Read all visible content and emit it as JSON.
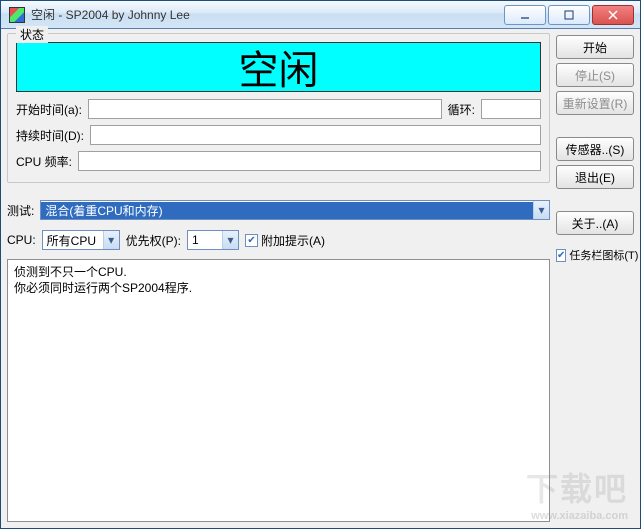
{
  "titlebar": {
    "title": "空闲 - SP2004 by Johnny Lee"
  },
  "status_group": {
    "label": "状态",
    "banner_text": "空闲",
    "start_time_label": "开始时间(a):",
    "loop_label": "循环:",
    "duration_label": "持续时间(D):",
    "cpu_freq_label": "CPU 频率:"
  },
  "test_row": {
    "label": "测试:",
    "selected": "混合(着重CPU和内存)"
  },
  "cpu_row": {
    "cpu_label": "CPU:",
    "cpu_selected": "所有CPU",
    "priority_label": "优先权(P):",
    "priority_value": "1",
    "extra_hint_label": "附加提示(A)"
  },
  "log_text": "侦测到不只一个CPU.\n你必须同时运行两个SP2004程序.",
  "buttons": {
    "start": "开始",
    "stop": "停止(S)",
    "reset": "重新设置(R)",
    "sensor": "传感器..(S)",
    "exit": "退出(E)",
    "about": "关于..(A)",
    "tray_label": "任务栏图标(T)"
  },
  "watermark": {
    "main": "下载吧",
    "sub": "www.xiazaiba.com"
  }
}
